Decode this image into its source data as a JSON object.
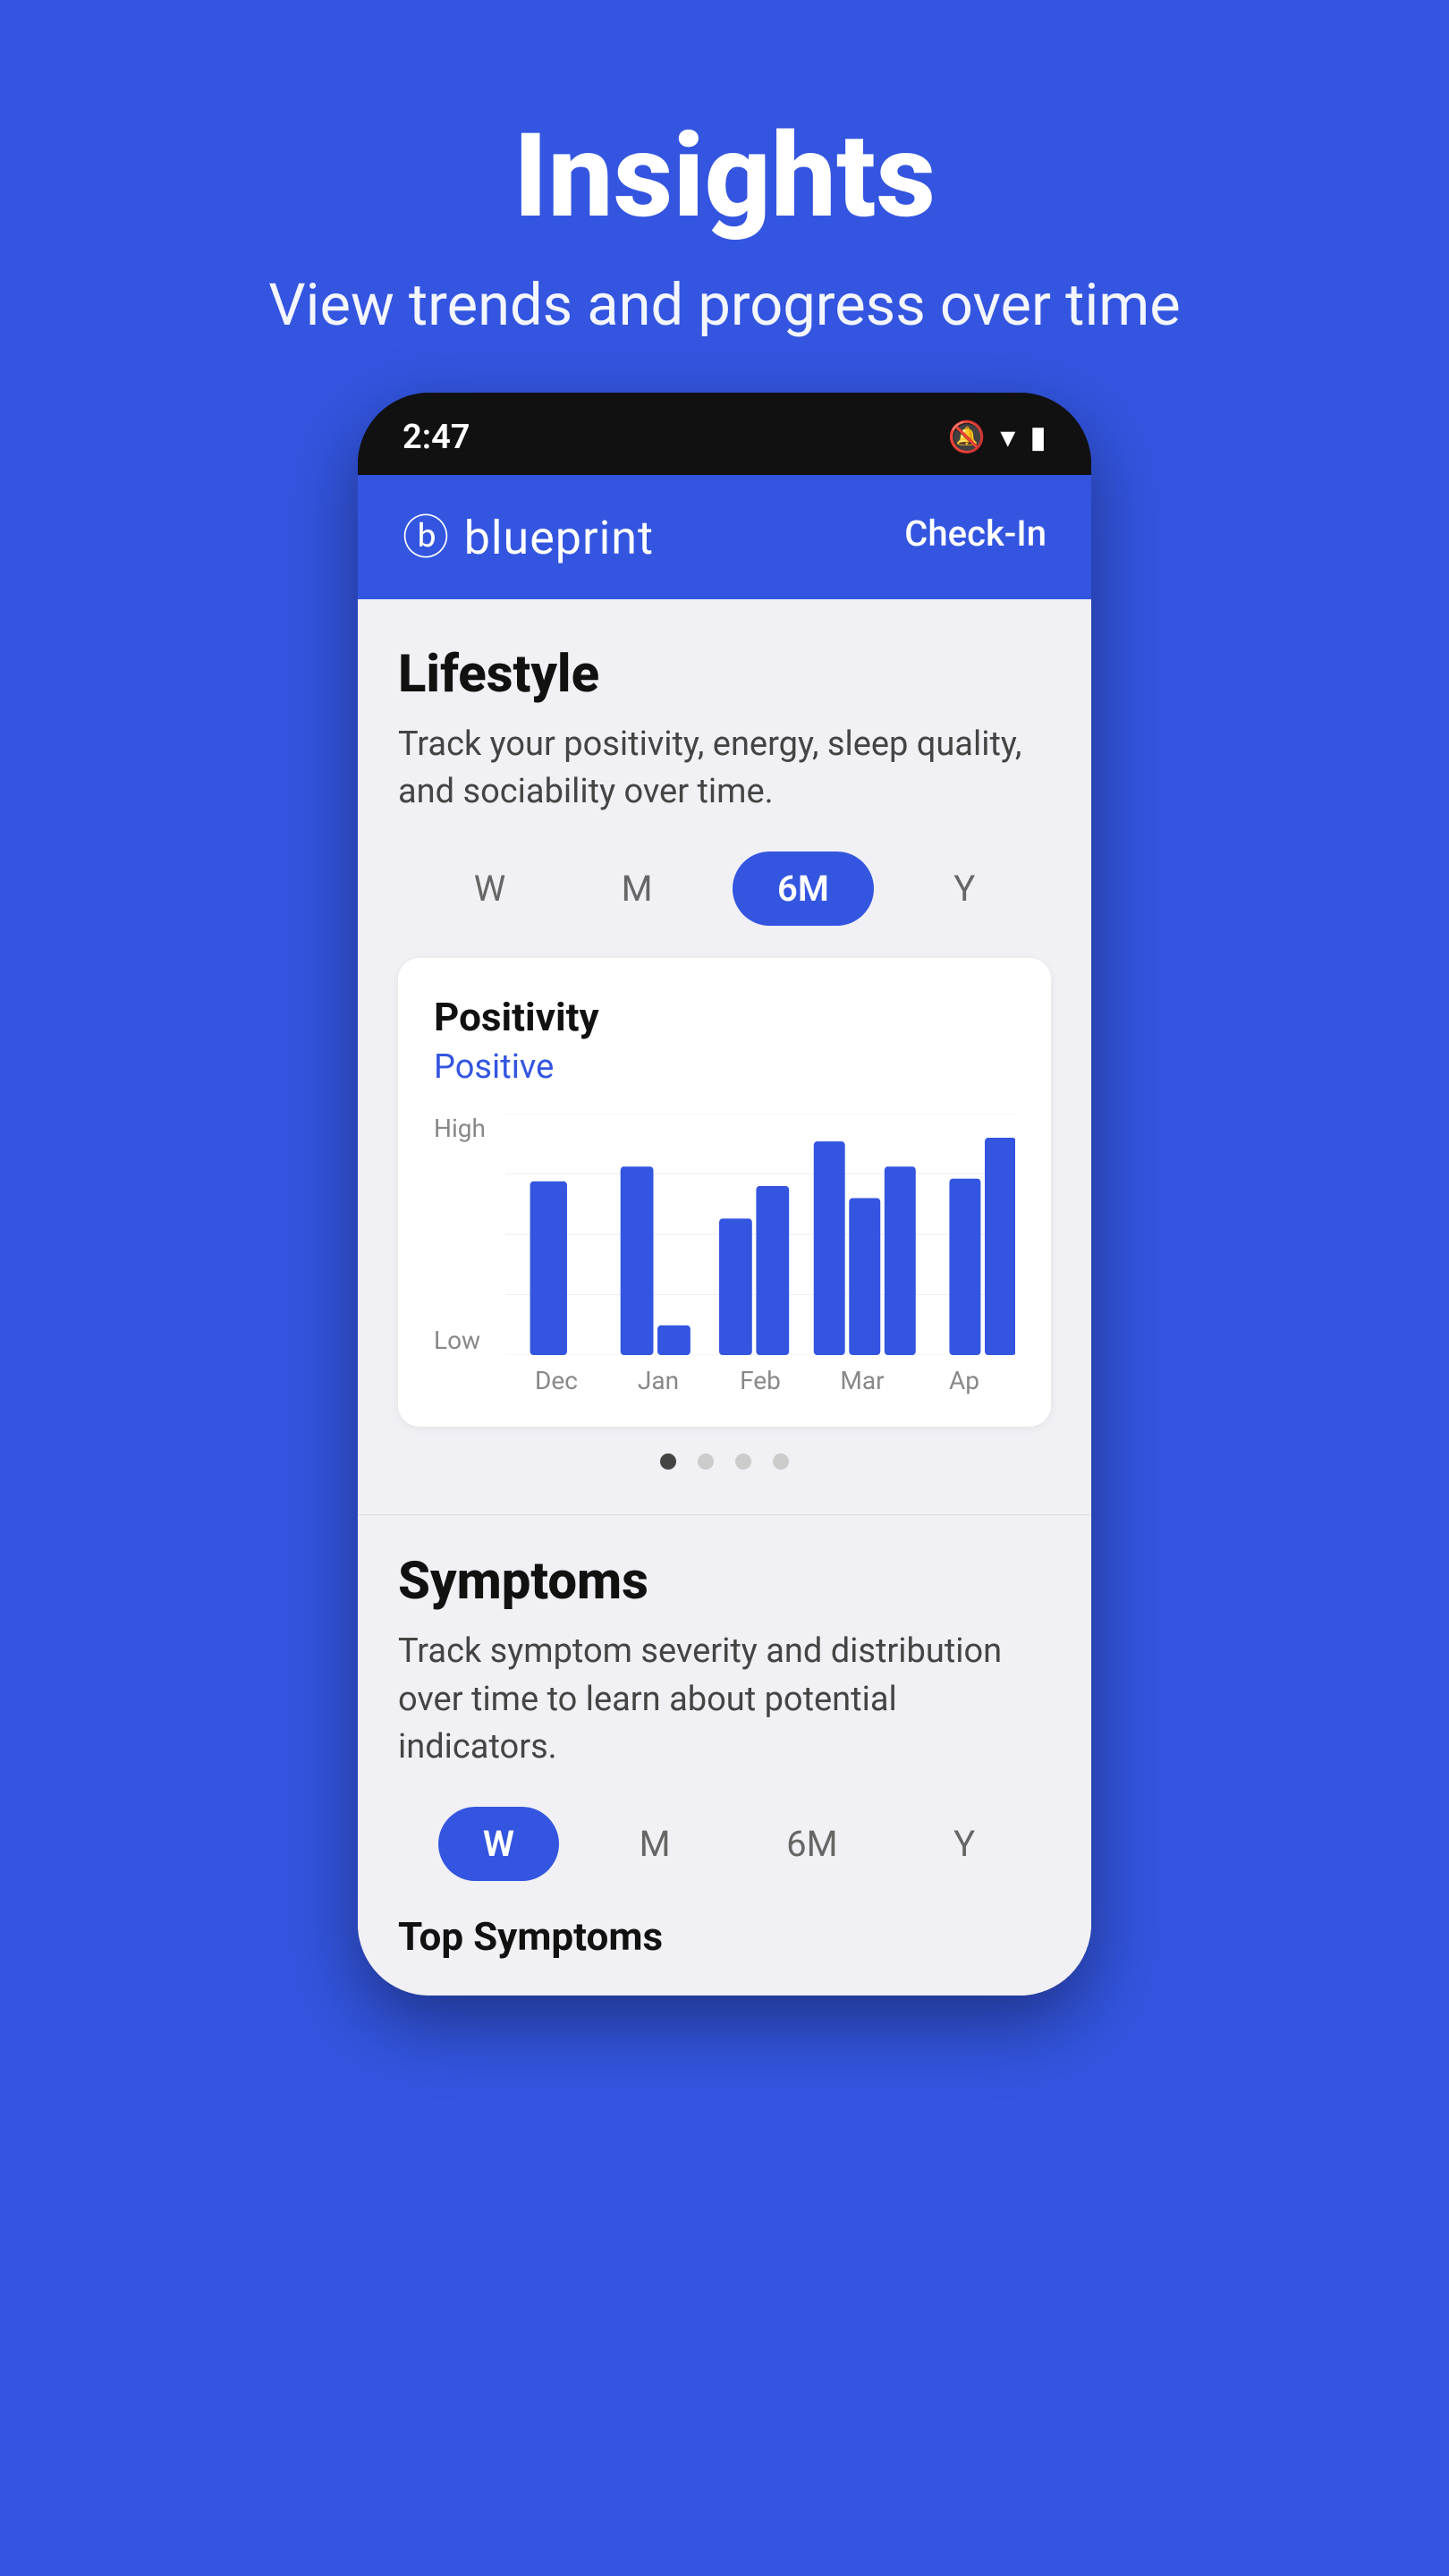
{
  "background_color": "#3355e0",
  "page_header": {
    "title": "Insights",
    "subtitle": "View trends and progress over time"
  },
  "phone": {
    "status_bar": {
      "time": "2:47",
      "icons": [
        "bell-mute",
        "wifi",
        "battery"
      ]
    },
    "app_header": {
      "logo": "blueprint",
      "check_in_label": "Check-In"
    },
    "lifestyle_section": {
      "title": "Lifestyle",
      "description": "Track your positivity, energy, sleep quality, and sociability over time.",
      "time_options": [
        "W",
        "M",
        "6M",
        "Y"
      ],
      "active_time": "6M",
      "chart": {
        "title": "Positivity",
        "subtitle": "Positive",
        "y_high": "High",
        "y_low": "Low",
        "x_labels": [
          "Dec",
          "Jan",
          "Feb",
          "Mar",
          "Ap"
        ],
        "bars": [
          {
            "month": "Dec",
            "values": [
              0.72
            ]
          },
          {
            "month": "Jan",
            "values": [
              0.78,
              0.22
            ]
          },
          {
            "month": "Feb",
            "values": [
              0.58,
              0.7
            ]
          },
          {
            "month": "Mar",
            "values": [
              0.88,
              0.65,
              0.78
            ]
          },
          {
            "month": "Ap",
            "values": [
              0.75,
              0.92
            ]
          }
        ]
      },
      "pagination_dots": [
        true,
        false,
        false,
        false
      ]
    },
    "symptoms_section": {
      "title": "Symptoms",
      "description": "Track symptom severity and distribution over time to learn about potential indicators.",
      "time_options": [
        "W",
        "M",
        "6M",
        "Y"
      ],
      "active_time": "W",
      "top_symptoms_label": "Top Symptoms"
    }
  }
}
